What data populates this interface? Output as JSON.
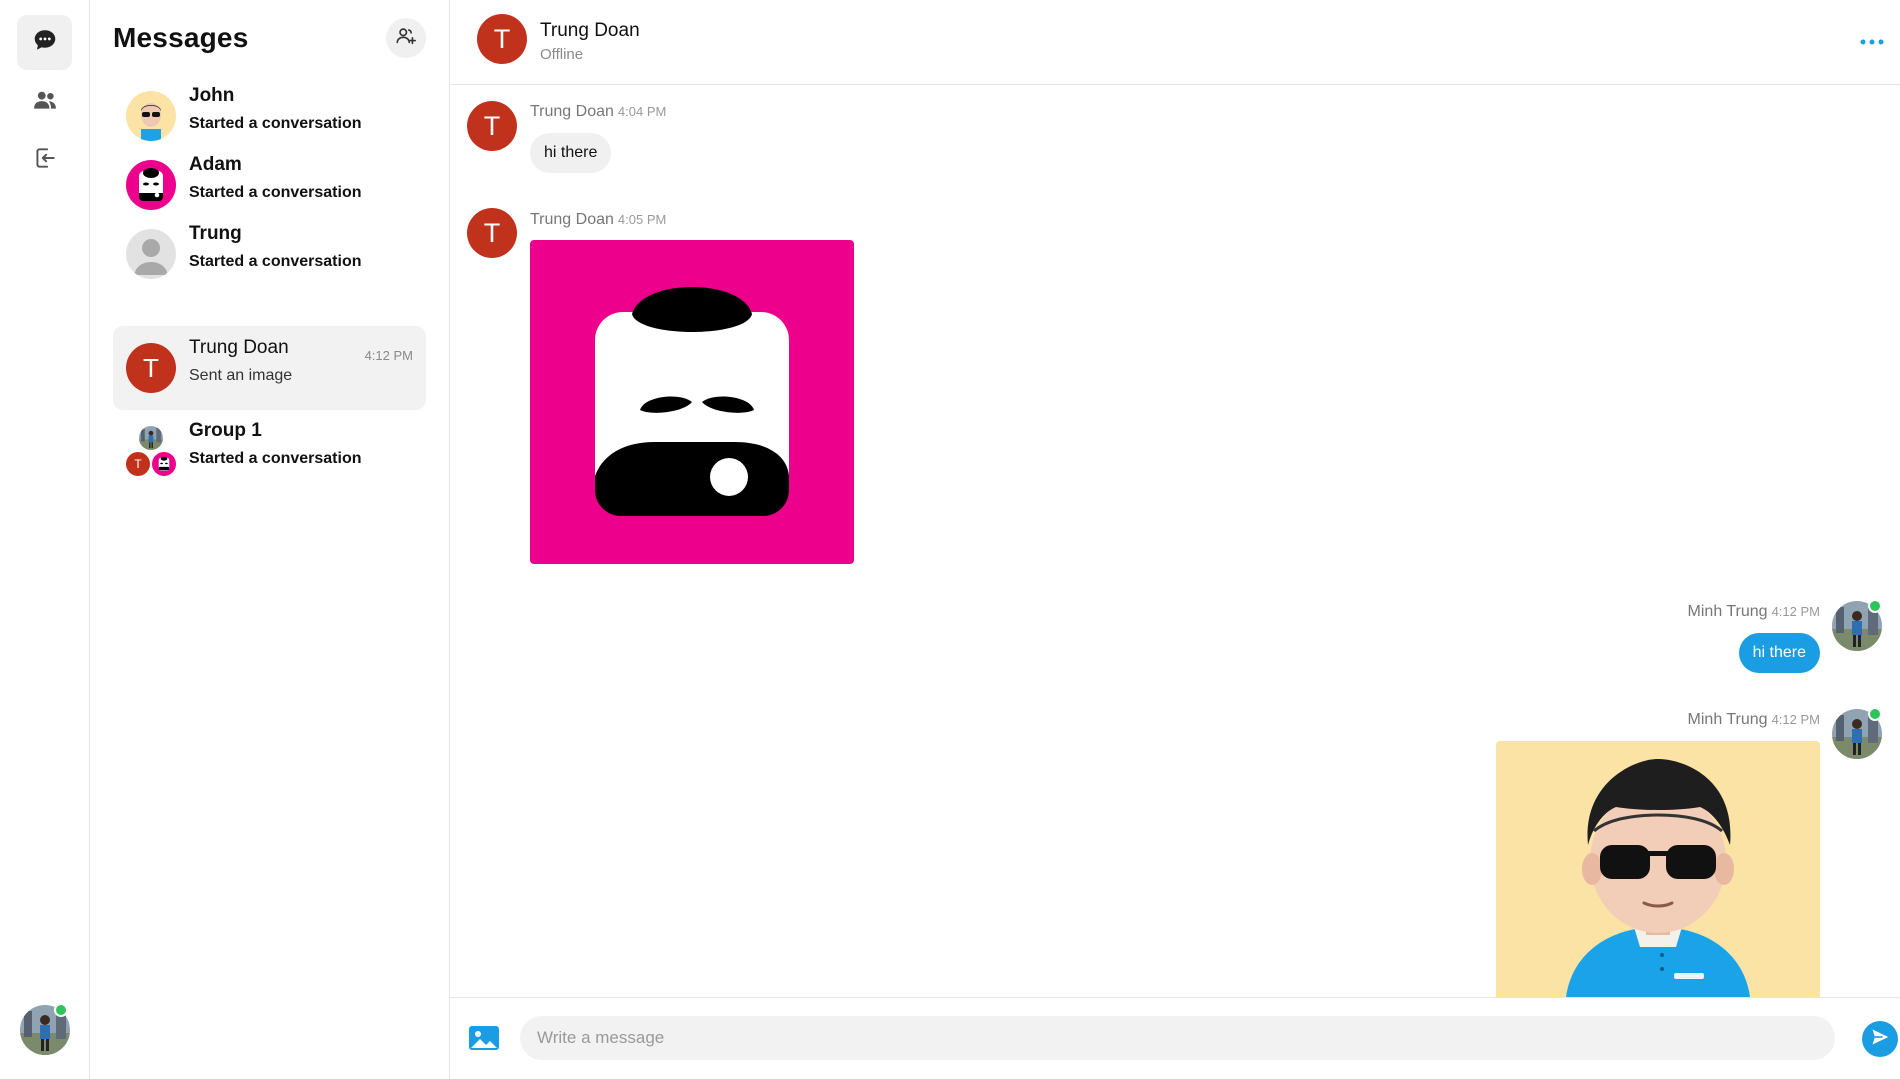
{
  "rail": {
    "items": [
      {
        "name": "messages",
        "icon": "chat-bubble-icon",
        "active": true
      },
      {
        "name": "contacts",
        "icon": "people-icon",
        "active": false
      },
      {
        "name": "logout",
        "icon": "logout-icon",
        "active": false
      }
    ],
    "user_online": true
  },
  "sidebar": {
    "title": "Messages",
    "new_chat_icon": "add-user-icon",
    "conversations": [
      {
        "name": "John",
        "preview": "Started a conversation",
        "time": "",
        "unread": true
      },
      {
        "name": "Adam",
        "preview": "Started a conversation",
        "time": "",
        "unread": true
      },
      {
        "name": "Trung",
        "preview": "Started a conversation",
        "time": "",
        "unread": true
      },
      {
        "name": "Trung Doan",
        "avatar_letter": "T",
        "preview": "Sent an image",
        "time": "4:12 PM",
        "unread": false,
        "active": true
      },
      {
        "name": "Group 1",
        "preview": "Started a conversation",
        "time": "",
        "unread": true,
        "group_letter": "T"
      }
    ]
  },
  "chat": {
    "header": {
      "avatar_letter": "T",
      "name": "Trung Doan",
      "status": "Offline"
    },
    "messages": [
      {
        "sender": "Trung Doan",
        "time": "4:04 PM",
        "avatar_letter": "T",
        "type": "text",
        "text": "hi there",
        "direction": "incoming"
      },
      {
        "sender": "Trung Doan",
        "time": "4:05 PM",
        "avatar_letter": "T",
        "type": "image",
        "image": "pink-avatar-image",
        "direction": "incoming"
      },
      {
        "sender": "Minh Trung",
        "time": "4:12 PM",
        "type": "text",
        "text": "hi there",
        "direction": "outgoing"
      },
      {
        "sender": "Minh Trung",
        "time": "4:12 PM",
        "type": "image",
        "image": "sunglasses-avatar-image",
        "direction": "outgoing"
      }
    ]
  },
  "composer": {
    "placeholder": "Write a message",
    "value": ""
  },
  "colors": {
    "accent": "#1a9de2",
    "letter_avatar": "#c0321b",
    "online": "#2ec45a",
    "pink": "#ec008c",
    "yellow": "#fbe3a6"
  }
}
